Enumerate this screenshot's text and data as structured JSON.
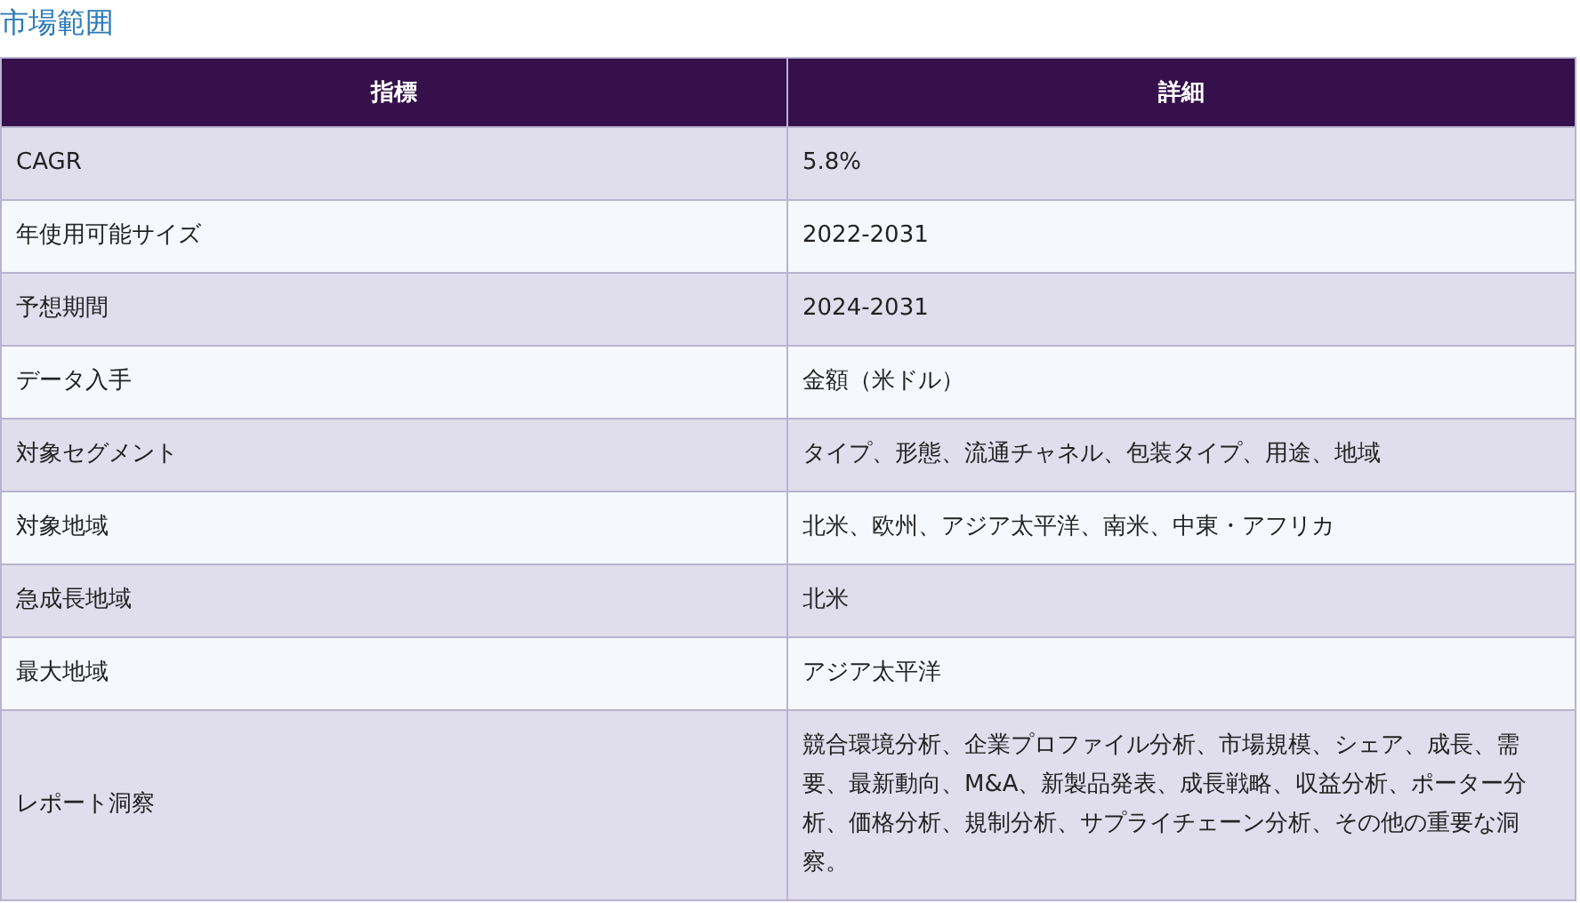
{
  "title": "市場範囲",
  "table": {
    "columns": [
      "指標",
      "詳細"
    ],
    "rows": [
      [
        "CAGR",
        "5.8%"
      ],
      [
        "年使用可能サイズ",
        "2022-2031"
      ],
      [
        "予想期間",
        "2024-2031"
      ],
      [
        "データ入手",
        "金額（米ドル）"
      ],
      [
        "対象セグメント",
        "タイプ、形態、流通チャネル、包装タイプ、用途、地域"
      ],
      [
        "対象地域",
        "北米、欧州、アジア太平洋、南米、中東・アフリカ"
      ],
      [
        "急成長地域",
        "北米"
      ],
      [
        "最大地域",
        "アジア太平洋"
      ],
      [
        "レポート洞察",
        "競合環境分析、企業プロファイル分析、市場規模、シェア、成長、需要、最新動向、M&A、新製品発表、成長戦略、収益分析、ポーター分析、価格分析、規制分析、サプライチェーン分析、その他の重要な洞察。"
      ]
    ]
  }
}
